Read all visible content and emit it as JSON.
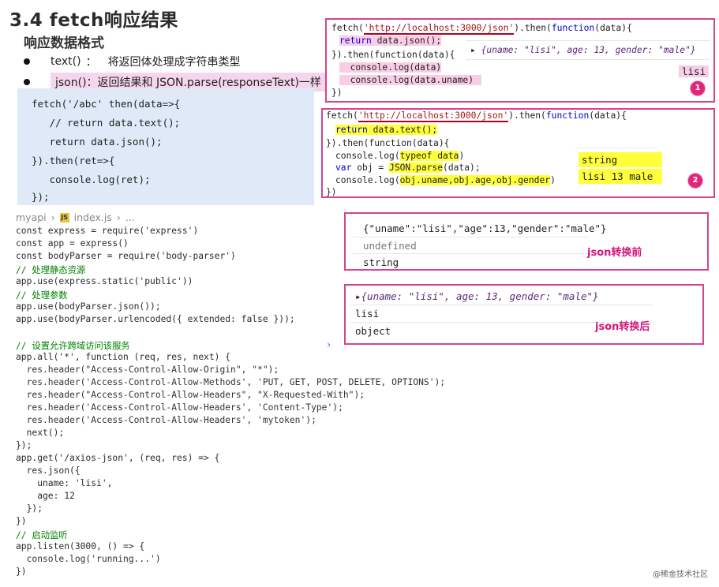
{
  "title": "3.4 fetch响应结果",
  "subtitle": "响应数据格式",
  "bullets": [
    {
      "label": "text()",
      "desc": "将返回体处理成字符串类型"
    },
    {
      "label": "json()",
      "desc": "返回结果和 JSON.parse(responseText)一样"
    }
  ],
  "snippet_lines": [
    "fetch('/abc' then(data=>{",
    "   // return data.text();",
    "   return data.json();",
    "}).then(ret=>{",
    "   console.log(ret);",
    "});"
  ],
  "breadcrumb": {
    "folder": "myapi",
    "file": "index.js",
    "more": "..."
  },
  "editor_lines": [
    "const express = require('express')",
    "const app = express()",
    "const bodyParser = require('body-parser')",
    "// 处理静态资源",
    "app.use(express.static('public'))",
    "// 处理参数",
    "app.use(bodyParser.json());",
    "app.use(bodyParser.urlencoded({ extended: false }));",
    "",
    "// 设置允许跨域访问该服务",
    "app.all('*', function (req, res, next) {",
    "  res.header(\"Access-Control-Allow-Origin\", \"*\");",
    "  res.header('Access-Control-Allow-Methods', 'PUT, GET, POST, DELETE, OPTIONS');",
    "  res.header(\"Access-Control-Allow-Headers\", \"X-Requested-With\");",
    "  res.header('Access-Control-Allow-Headers', 'Content-Type');",
    "  res.header('Access-Control-Allow-Headers', 'mytoken');",
    "  next();",
    "});",
    "app.get('/axios-json', (req, res) => {",
    "  res.json({",
    "    uname: 'lisi',",
    "    age: 12",
    "  });",
    "})",
    "// 启动监听",
    "app.listen(3000, () => {",
    "  console.log('running...')",
    "})"
  ],
  "panel1": {
    "lines": [
      "fetch('http://localhost:3000/json').then(function(data){",
      "  return data.json();",
      "}).then(function(data){",
      "  console.log(data)",
      "  console.log(data.uname)",
      "})"
    ],
    "output_obj": "{uname: \"lisi\", age: 13, gender: \"male\"}",
    "output_uname": "lisi",
    "badge": "1"
  },
  "panel2": {
    "lines": [
      "fetch('http://localhost:3000/json').then(function(data){",
      "  return data.text();",
      "}).then(function(data){",
      "  console.log(typeof data)",
      "  var obj = JSON.parse(data);",
      "  console.log(obj.uname,obj.age,obj.gender)",
      "})"
    ],
    "output_type": "string",
    "output_values": "lisi 13 male",
    "badge": "2"
  },
  "panel3": {
    "lines": [
      "{\"uname\":\"lisi\",\"age\":13,\"gender\":\"male\"}",
      "undefined",
      "string"
    ],
    "label": "json转换前"
  },
  "panel4": {
    "lines": [
      "{uname: \"lisi\", age: 13, gender: \"male\"}",
      "lisi",
      "object"
    ],
    "label": "json转换后"
  },
  "watermark": "@稀金技术社区",
  "colors": {
    "panel_border": "#d4448e",
    "highlight_pink": "#f9cde6",
    "highlight_yellow": "#ffff3a",
    "snippet_bg": "#dfe9f8"
  },
  "icons": [
    "bullet-dot",
    "js-file-icon",
    "chevron-right-icon",
    "expand-arrow-icon"
  ]
}
